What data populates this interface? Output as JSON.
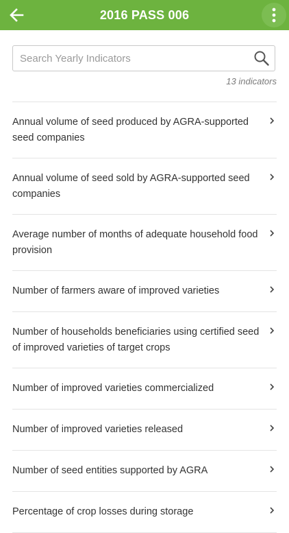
{
  "app_bar": {
    "title": "2016 PASS 006",
    "background": "#6db33f"
  },
  "search": {
    "placeholder": "Search Yearly Indicators",
    "value": "",
    "icon": "search-icon"
  },
  "count_label": "13 indicators",
  "indicators": [
    {
      "label": "Annual volume of seed produced by AGRA-supported seed companies"
    },
    {
      "label": "Annual volume of seed sold by AGRA-supported seed companies"
    },
    {
      "label": "Average number of months of adequate household food provision"
    },
    {
      "label": "Number of farmers aware of improved varieties"
    },
    {
      "label": "Number of households beneficiaries using certified seed of improved varieties of target crops"
    },
    {
      "label": "Number of improved varieties commercialized"
    },
    {
      "label": "Number of improved varieties released"
    },
    {
      "label": "Number of seed entities supported by AGRA"
    },
    {
      "label": "Percentage of crop losses during storage"
    }
  ]
}
